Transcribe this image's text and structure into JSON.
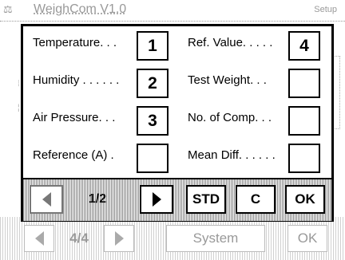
{
  "background": {
    "title": "WeighCom V1.0",
    "status": "Setup",
    "footer": {
      "page": "4/4",
      "system_label": "System",
      "ok_label": "OK"
    }
  },
  "dialog": {
    "rows": [
      {
        "left_label": "Temperature. . .",
        "left_value": "1",
        "right_label": "Ref. Value. . . . .",
        "right_value": "4"
      },
      {
        "left_label": "Humidity . . . . . .",
        "left_value": "2",
        "right_label": "Test Weight. . .",
        "right_value": ""
      },
      {
        "left_label": "Air Pressure. . .",
        "left_value": "3",
        "right_label": "No. of Comp. . .",
        "right_value": ""
      },
      {
        "left_label": "Reference (A) .",
        "left_value": "",
        "right_label": "Mean Diff. . . . . .",
        "right_value": ""
      }
    ],
    "toolbar": {
      "page_indicator": "1/2",
      "std_label": "STD",
      "c_label": "C",
      "ok_label": "OK"
    }
  },
  "icons": [
    "arrow-left-icon",
    "arrow-right-icon",
    "device-icon"
  ]
}
